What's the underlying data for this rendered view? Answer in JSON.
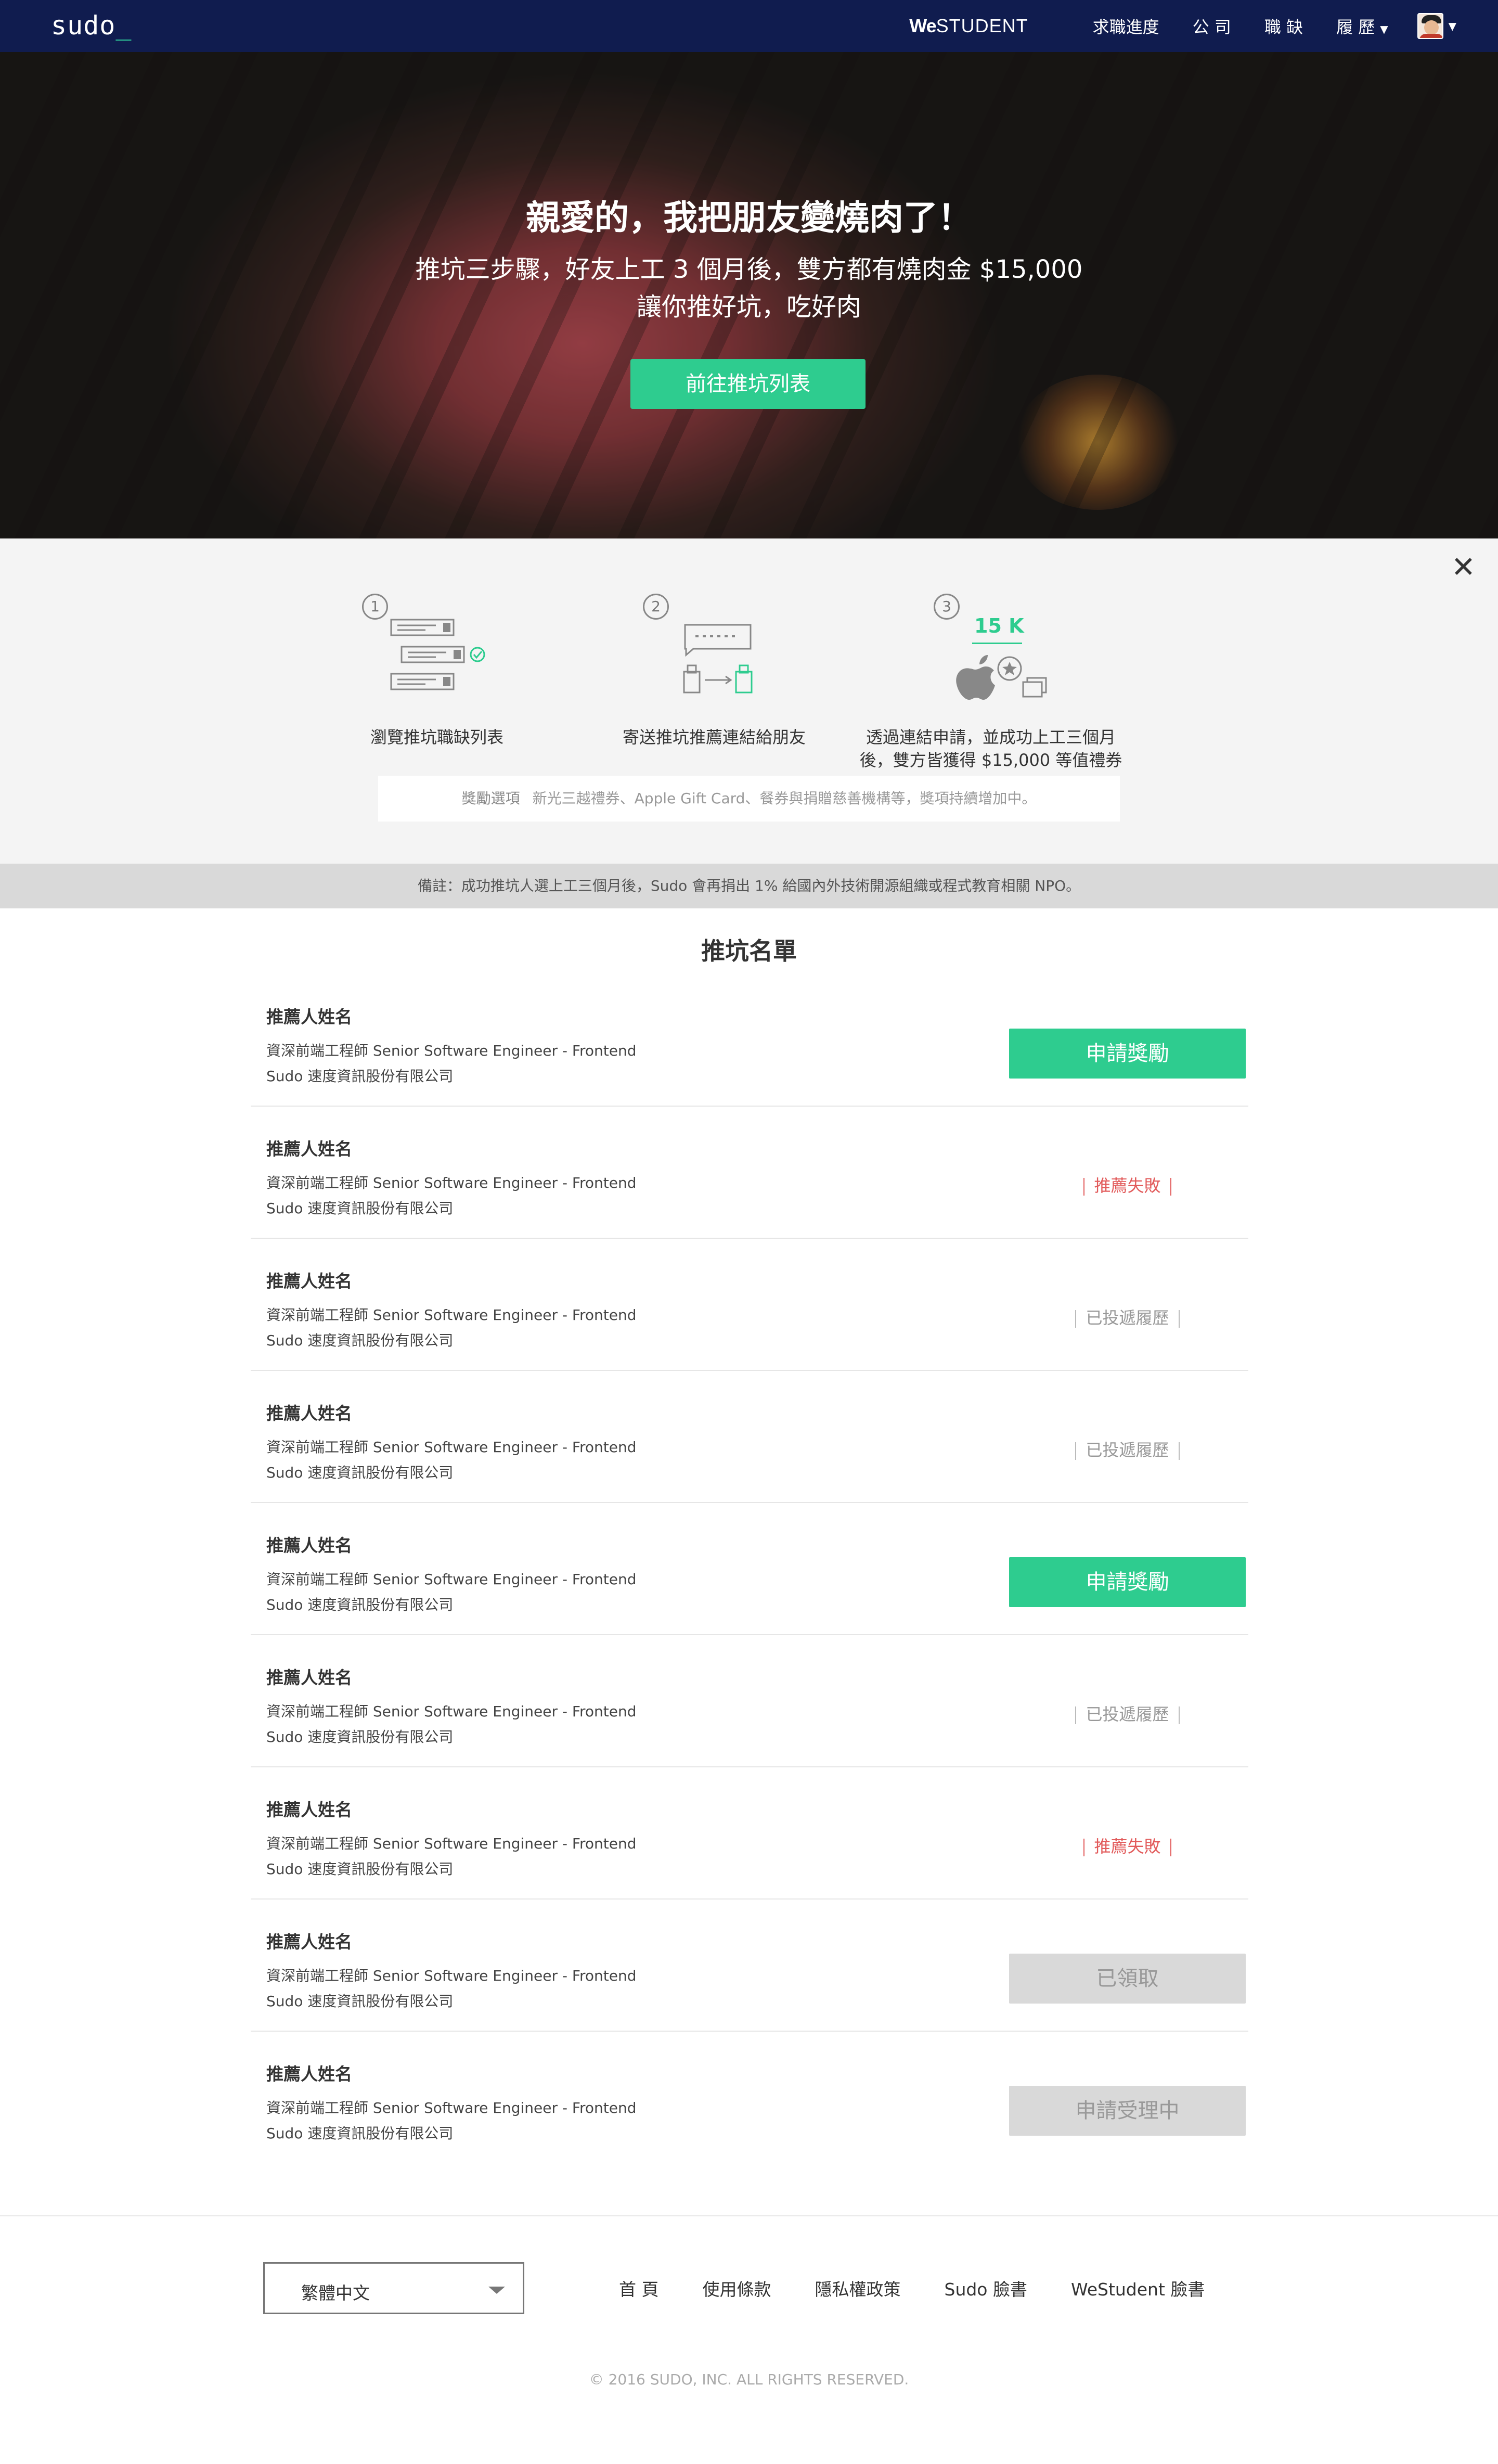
{
  "nav": {
    "logo": "sudo",
    "logo_cursor": "_",
    "brand_we": "We",
    "brand_student": "STUDENT",
    "links": [
      "求職進度",
      "公 司",
      "職 缺",
      "履 歷"
    ],
    "colors": {
      "bg": "#101c4f",
      "accent": "#2ecc9a"
    }
  },
  "hero": {
    "title": "親愛的，我把朋友變燒肉了！",
    "subtitle_1": "推坑三步驟，好友上工 3 個月後，雙方都有燒肉金 $15,000",
    "subtitle_2": "讓你推好坑，吃好肉",
    "cta": "前往推坑列表"
  },
  "steps": {
    "close_icon": "close-icon",
    "items": [
      {
        "num": "1",
        "icon": "job-list-check-icon",
        "label_1": "瀏覽推坑職缺列表",
        "label_2": ""
      },
      {
        "num": "2",
        "icon": "share-link-icon",
        "label_1": "寄送推坑推薦連結給朋友",
        "label_2": ""
      },
      {
        "num": "3",
        "icon": "gift-reward-icon",
        "badge": "15 K",
        "label_1": "透過連結申請，並成功上工三個月",
        "label_2": "後，雙方皆獲得 $15,000 等值禮券"
      }
    ],
    "reward_key": "獎勵選項",
    "reward_value": "新光三越禮券、Apple Gift Card、餐券與捐贈慈善機構等，獎項持續增加中。",
    "note": "備註：成功推坑人選上工三個月後，Sudo 會再捐出 1% 給國內外技術開源組織或程式教育相關 NPO。"
  },
  "list": {
    "title": "推坑名單",
    "rows": [
      {
        "name": "推薦人姓名",
        "job": "資深前端工程師 Senior Software Engineer - Frontend",
        "company": "Sudo 速度資訊股份有限公司",
        "kind": "button-green",
        "status": "申請獎勵"
      },
      {
        "name": "推薦人姓名",
        "job": "資深前端工程師 Senior Software Engineer - Frontend",
        "company": "Sudo 速度資訊股份有限公司",
        "kind": "status-fail",
        "status": "推薦失敗"
      },
      {
        "name": "推薦人姓名",
        "job": "資深前端工程師 Senior Software Engineer - Frontend",
        "company": "Sudo 速度資訊股份有限公司",
        "kind": "status-sent",
        "status": "已投遞履歷"
      },
      {
        "name": "推薦人姓名",
        "job": "資深前端工程師 Senior Software Engineer - Frontend",
        "company": "Sudo 速度資訊股份有限公司",
        "kind": "status-sent",
        "status": "已投遞履歷"
      },
      {
        "name": "推薦人姓名",
        "job": "資深前端工程師 Senior Software Engineer - Frontend",
        "company": "Sudo 速度資訊股份有限公司",
        "kind": "button-green",
        "status": "申請獎勵"
      },
      {
        "name": "推薦人姓名",
        "job": "資深前端工程師 Senior Software Engineer - Frontend",
        "company": "Sudo 速度資訊股份有限公司",
        "kind": "status-sent",
        "status": "已投遞履歷"
      },
      {
        "name": "推薦人姓名",
        "job": "資深前端工程師 Senior Software Engineer - Frontend",
        "company": "Sudo 速度資訊股份有限公司",
        "kind": "status-fail",
        "status": "推薦失敗"
      },
      {
        "name": "推薦人姓名",
        "job": "資深前端工程師 Senior Software Engineer - Frontend",
        "company": "Sudo 速度資訊股份有限公司",
        "kind": "button-gray",
        "status": "已領取"
      },
      {
        "name": "推薦人姓名",
        "job": "資深前端工程師 Senior Software Engineer - Frontend",
        "company": "Sudo 速度資訊股份有限公司",
        "kind": "button-gray",
        "status": "申請受理中"
      }
    ],
    "colors": {
      "green": "#2ecc8f",
      "fail": "#e25c5c",
      "muted": "#999999"
    }
  },
  "footer": {
    "language": "繁體中文",
    "links": [
      "首 頁",
      "使用條款",
      "隱私權政策",
      "Sudo 臉書",
      "WeStudent 臉書"
    ],
    "copyright": "© 2016 SUDO, INC. ALL RIGHTS RESERVED."
  }
}
